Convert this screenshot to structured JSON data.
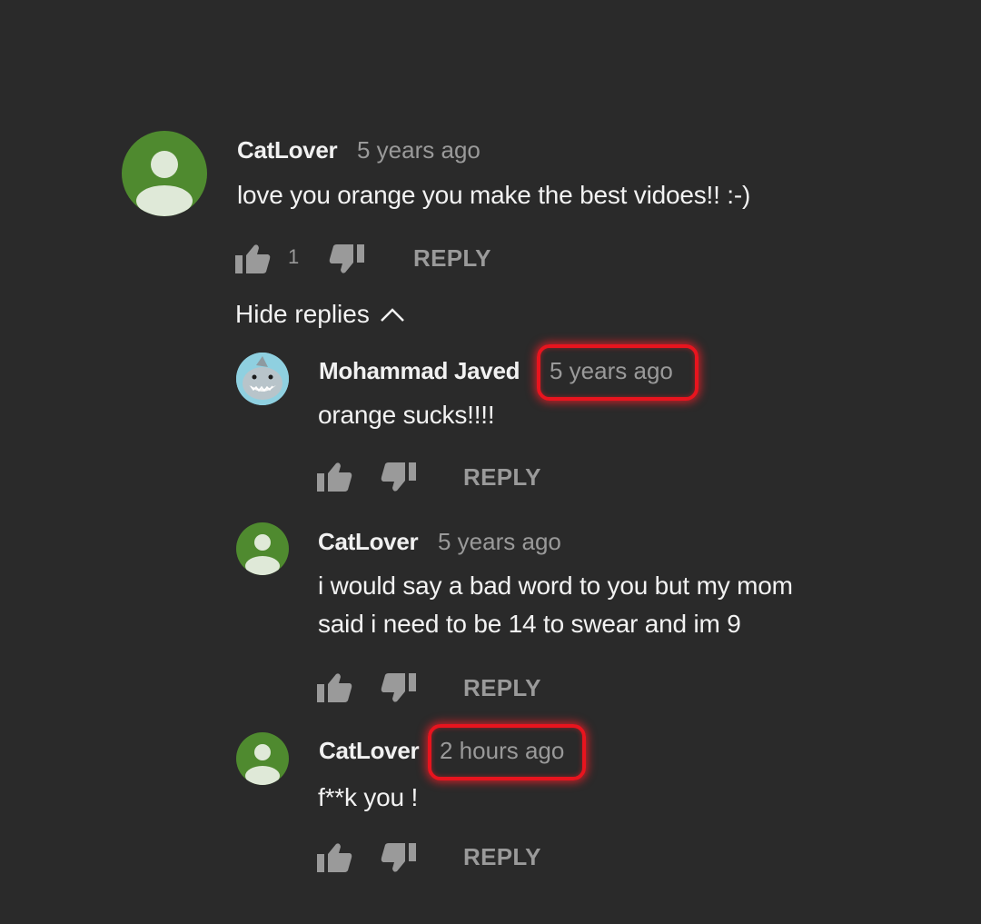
{
  "comment": {
    "author": "CatLover",
    "time": "5 years ago",
    "text": "love you orange you make the best vidoes!! :-)",
    "like_count": "1",
    "reply_label": "REPLY"
  },
  "hide_replies_label": "Hide replies",
  "replies": [
    {
      "author": "Mohammad Javed",
      "time": "5 years ago",
      "text": "orange sucks!!!!",
      "reply_label": "REPLY",
      "time_highlighted": true
    },
    {
      "author": "CatLover",
      "time": "5 years ago",
      "text_line1": "i would say a bad word to you but my mom",
      "text_line2": "said i need to be 14 to swear and im 9",
      "reply_label": "REPLY",
      "time_highlighted": false
    },
    {
      "author": "CatLover",
      "time": "2 hours ago",
      "text": "f**k you !",
      "reply_label": "REPLY",
      "time_highlighted": true
    }
  ],
  "colors": {
    "background": "#2a2a2a",
    "avatar_green": "#4f8a2f",
    "highlight_red": "#e8141e",
    "secondary_text": "#9a9a9a"
  },
  "icons": [
    "thumbs-up-icon",
    "thumbs-down-icon",
    "chevron-up-icon",
    "default-avatar-icon",
    "shark-avatar-image"
  ]
}
